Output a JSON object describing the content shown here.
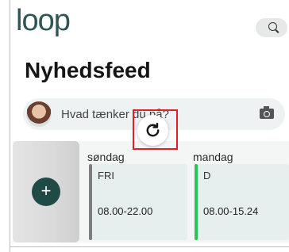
{
  "app": {
    "logo_text": "loop"
  },
  "header": {
    "search_icon": "search-icon"
  },
  "page": {
    "title": "Nyhedsfeed"
  },
  "composer": {
    "placeholder": "Hvad tænker du på?",
    "camera_icon": "camera-icon"
  },
  "refresh": {
    "icon": "refresh-icon",
    "highlight_color": "#e21f26"
  },
  "shifts": {
    "add_label": "+",
    "days": [
      {
        "day": "søndag",
        "code": "FRI",
        "time": "08.00-22.00",
        "color": "#7d7d7d"
      },
      {
        "day": "mandag",
        "code": "D",
        "time": "08.00-15.24",
        "color": "#2cc35a"
      }
    ]
  },
  "colors": {
    "brand": "#2f5554",
    "add_button": "#1f4a45"
  }
}
